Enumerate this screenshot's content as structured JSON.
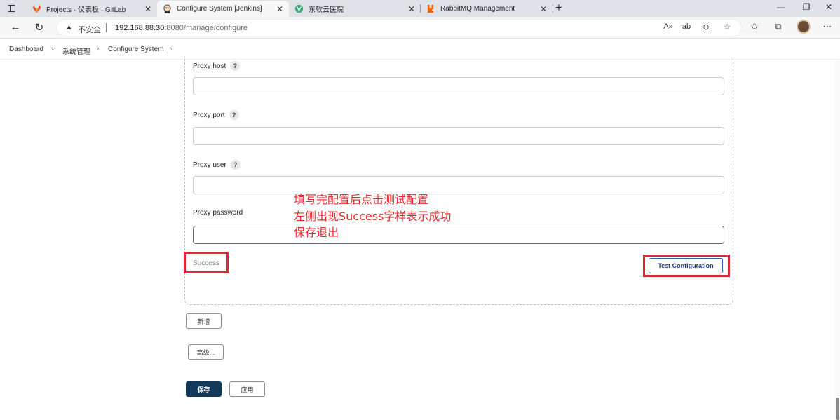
{
  "browser": {
    "tabs": [
      {
        "label": "Projects · 仪表板 · GitLab",
        "icon": "gitlab-icon",
        "active": false
      },
      {
        "label": "Configure System [Jenkins]",
        "icon": "jenkins-icon",
        "active": true
      },
      {
        "label": "东软云医院",
        "icon": "vue-icon",
        "active": false
      },
      {
        "label": "RabbitMQ Management",
        "icon": "rabbitmq-icon",
        "active": false
      }
    ],
    "window_controls": {
      "minimize": "—",
      "maximize": "❐",
      "close": "✕"
    },
    "address": {
      "security_label": "不安全",
      "url_host": "192.168.88.30",
      "url_path": ":8080/manage/configure"
    }
  },
  "breadcrumb": {
    "items": [
      "Dashboard",
      "系统管理",
      "Configure System"
    ],
    "separator": "›"
  },
  "proxy": {
    "fields": [
      {
        "label": "Proxy host",
        "help": "?",
        "value": ""
      },
      {
        "label": "Proxy port",
        "help": "?",
        "value": ""
      },
      {
        "label": "Proxy user",
        "help": "?",
        "value": ""
      },
      {
        "label": "Proxy password",
        "value": ""
      }
    ],
    "result_text": "Success",
    "test_button_label": "Test Configuration"
  },
  "annotation": {
    "lines": [
      "填写完配置后点击测试配置",
      "左侧出现Success字样表示成功",
      "保存退出"
    ],
    "color": "#e8262c"
  },
  "buttons": {
    "add_label": "新增",
    "advanced_label": "高级...",
    "save_label": "保存",
    "apply_label": "应用"
  },
  "colors": {
    "primary_button": "#12395a",
    "highlight_box": "#e02a33",
    "tab_strip": "#dfe3e8"
  }
}
